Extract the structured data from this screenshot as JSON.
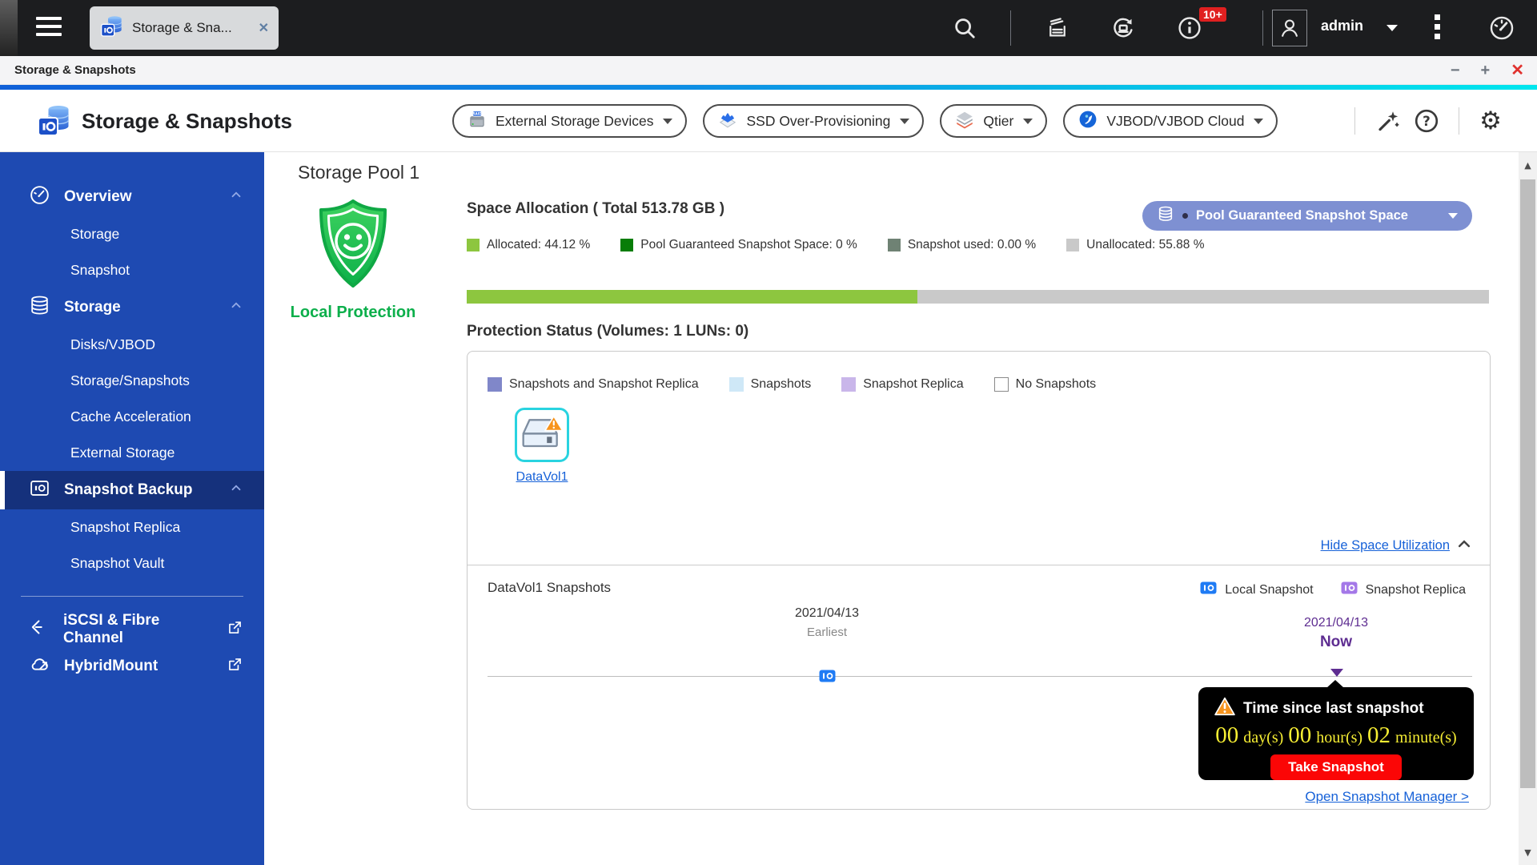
{
  "colors": {
    "sidebar_blue": "#1e4ab2",
    "accent_green": "#0caf4b",
    "timeline_purple": "#5e2d91",
    "link_blue": "#1661d8",
    "tooltip_yellow": "#f6ee33",
    "alert_red": "#fb0606",
    "badge_red": "#e02020"
  },
  "topbar": {
    "tab_label": "Storage & Sna...",
    "badge": "10+",
    "user": "admin"
  },
  "titlebar": {
    "title": "Storage & Snapshots"
  },
  "header": {
    "app_title": "Storage & Snapshots",
    "menus": [
      {
        "label": "External Storage Devices"
      },
      {
        "label": "SSD Over-Provisioning"
      },
      {
        "label": "Qtier"
      },
      {
        "label": "VJBOD/VJBOD Cloud"
      }
    ]
  },
  "sidebar": {
    "items": [
      {
        "label": "Overview"
      },
      {
        "label": "Storage"
      },
      {
        "label": "Snapshot"
      },
      {
        "label": "Storage"
      },
      {
        "label": "Disks/VJBOD"
      },
      {
        "label": "Storage/Snapshots"
      },
      {
        "label": "Cache Acceleration"
      },
      {
        "label": "External Storage"
      },
      {
        "label": "Snapshot Backup"
      },
      {
        "label": "Snapshot Replica"
      },
      {
        "label": "Snapshot Vault"
      },
      {
        "label": "iSCSI & Fibre Channel"
      },
      {
        "label": "HybridMount"
      }
    ]
  },
  "main": {
    "pool_title": "Storage Pool 1",
    "protection_label": "Local Protection",
    "space": {
      "title": "Space Allocation ( Total 513.78 GB )",
      "legend": [
        {
          "label": "Allocated: 44.12 %",
          "color": "#8dc63f"
        },
        {
          "label": "Pool Guaranteed Snapshot Space: 0 %",
          "color": "#077d07"
        },
        {
          "label": "Snapshot used: 0.00 %",
          "color": "#6f8274"
        },
        {
          "label": "Unallocated: 55.88 %",
          "color": "#c9c9c9"
        }
      ],
      "allocated_pct": 44.12,
      "bar_track_color": "#c9c9c9",
      "bar_fill_color": "#8dc63f",
      "pill_label": "Pool Guaranteed Snapshot Space"
    },
    "protection": {
      "title": "Protection Status (Volumes: 1 LUNs: 0)",
      "legend": [
        {
          "label": "Snapshots and Snapshot Replica",
          "color": "#8087c9"
        },
        {
          "label": "Snapshots",
          "color": "#cfe8f7"
        },
        {
          "label": "Snapshot Replica",
          "color": "#c9b6ea"
        },
        {
          "label": "No Snapshots",
          "color": "#ffffff"
        }
      ],
      "volume_label": "DataVol1",
      "hide_link": "Hide Space Utilization"
    },
    "snapshots": {
      "title": "DataVol1 Snapshots",
      "legend": [
        {
          "label": "Local Snapshot",
          "color": "#1f7bf4"
        },
        {
          "label": "Snapshot Replica",
          "color": "#a478e8"
        }
      ],
      "earliest_date": "2021/04/13",
      "earliest_label": "Earliest",
      "now_date": "2021/04/13",
      "now_label": "Now",
      "tooltip": {
        "title": "Time since last snapshot",
        "days": "00",
        "days_unit": "day(s)",
        "hours": "00",
        "hours_unit": "hour(s)",
        "minutes": "02",
        "minutes_unit": "minute(s)",
        "button_label": "Take Snapshot"
      },
      "manager_link": "Open Snapshot Manager >"
    }
  }
}
